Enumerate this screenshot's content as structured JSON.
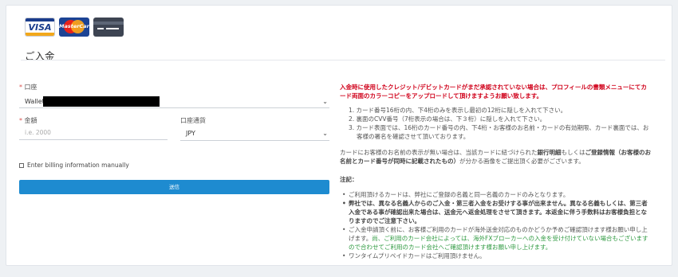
{
  "page": {
    "title": "ご入金"
  },
  "card_logos": [
    {
      "name": "visa",
      "label": "VISA"
    },
    {
      "name": "mastercard",
      "label": "MasterCard"
    },
    {
      "name": "generic-card",
      "label": ""
    }
  ],
  "form": {
    "account_label": "口座",
    "account_value": "Wallet",
    "amount_label": "金額",
    "amount_placeholder": "i.e. 2000",
    "currency_label": "口座通貨",
    "currency_value": "JPY",
    "manual_billing_label": "Enter billing information manually",
    "submit_label": "送信"
  },
  "info": {
    "warning": "入金時に使用したクレジット/デビットカードがまだ承認されていない場合は、プロフィールの書類メニューにてカード両面のカラーコピーをアップロードして頂けますようお願い致します。",
    "steps": [
      "1. カード番号16桁の内、下4桁のみを表示し最初の12桁に隠しを入れて下さい。",
      "2. 裏面のCVV番号（7桁表示の場合は、下３桁）に隠しを入れて下さい。",
      "3. カード表面では、16桁のカード番号の内、下4桁・お客様のお名前・カードの有効期限、カード裏面では、お客様の署名を確認させて頂いております。"
    ],
    "name_note_prefix": "カードにお客様のお名前の表示が無い場合は、当該カードに紐づけられた",
    "name_note_bold1": "銀行明細",
    "name_note_mid": "もしくは",
    "name_note_bold2": "ご登録情報（お客様のお名前とカード番号が同時に記載されたもの）",
    "name_note_suffix": "が分かる画像をご提出頂く必要がございます。",
    "notes_heading": "注記：",
    "notes": [
      {
        "text": "ご利用頂けるカードは、弊社にご登録の名義と同一名義のカードのみとなります。",
        "style": "normal"
      },
      {
        "text": "弊社では、異なる名義人からのご入金・第三者入金をお受けする事が出来ません。異なる名義もしくは、第三者入金である事が確認出来た場合は、送金元へ返金処理をさせて頂きます。本返金に伴う手数料はお客様負担となりますのでご注意下さい。",
        "style": "bold"
      },
      {
        "text": "ご入金申請頂く前に、お客様ご利用のカードが海外送金対応のものかどうか予めご確認頂けます様お願い申し上げます。",
        "style": "normal"
      },
      {
        "text": "尚、ご利用のカード会社によっては、海外FXブローカーへの入金を受け付けていない場合もございますので合わせてご利用のカード会社へご確認頂けます様お願い申し上げます。",
        "style": "green"
      },
      {
        "text": "ワンタイムプリペイドカードはご利用頂けません。",
        "style": "normal"
      }
    ]
  },
  "colors": {
    "accent": "#1e8bd0",
    "warning": "#d0021b",
    "green_note": "#2f9a41",
    "background": "#eef1f4"
  }
}
